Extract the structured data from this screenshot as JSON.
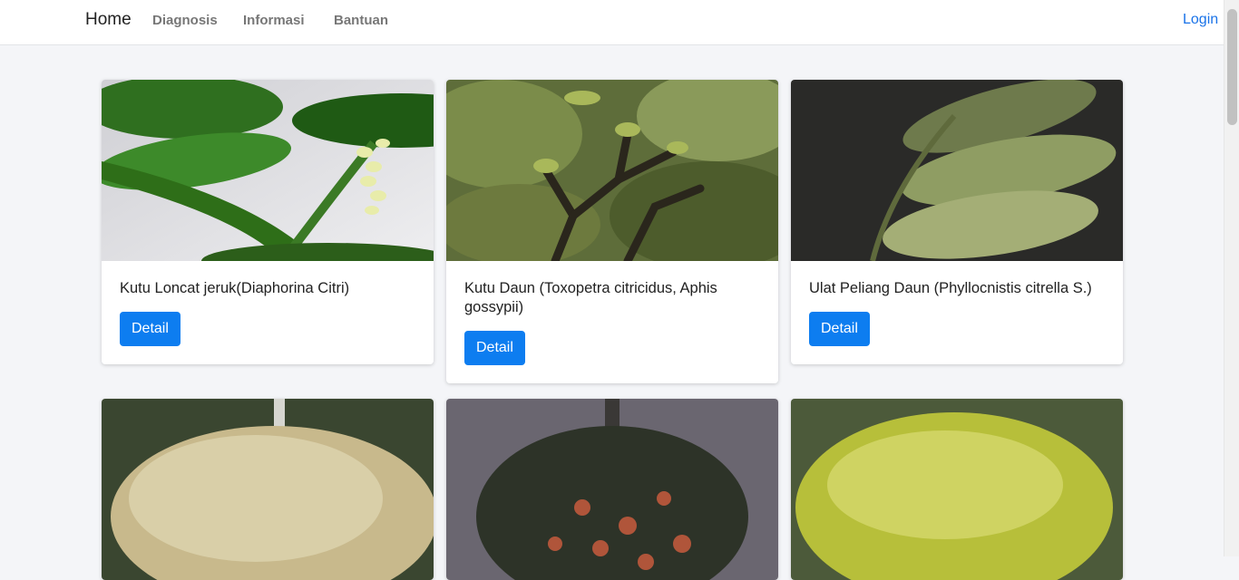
{
  "nav": {
    "brand": "Home",
    "links": [
      "Diagnosis",
      "Informasi",
      "Bantuan"
    ],
    "login": "Login"
  },
  "cards": [
    {
      "title": "Kutu Loncat jeruk(Diaphorina Citri)",
      "button": "Detail"
    },
    {
      "title": "Kutu Daun (Toxopetra citricidus, Aphis gossypii)",
      "button": "Detail"
    },
    {
      "title": "Ulat Peliang Daun (Phyllocnistis citrella S.)",
      "button": "Detail"
    }
  ]
}
